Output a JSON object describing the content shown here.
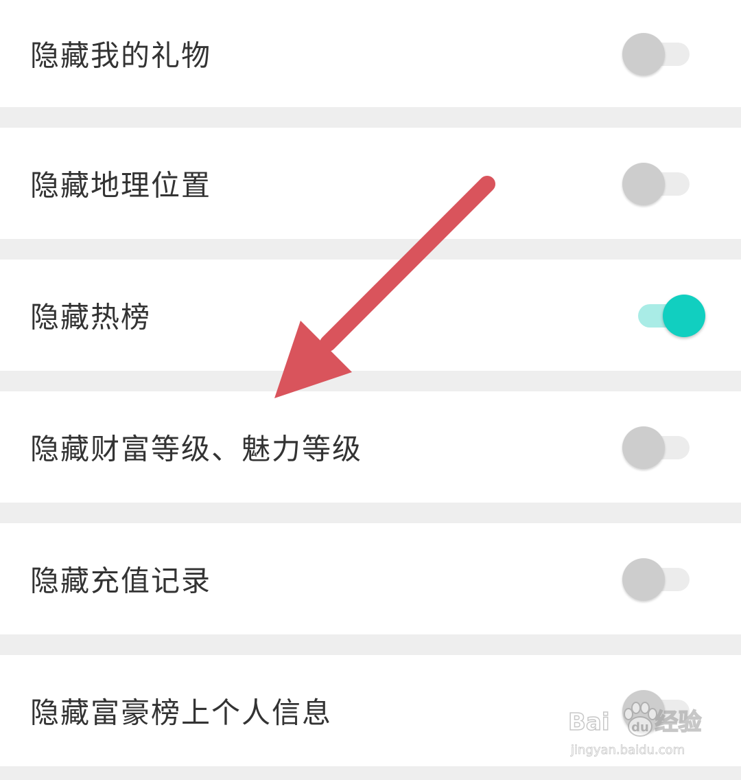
{
  "settings": {
    "items": [
      {
        "label": "隐藏我的礼物",
        "enabled": false
      },
      {
        "label": "隐藏地理位置",
        "enabled": false
      },
      {
        "label": "隐藏热榜",
        "enabled": true
      },
      {
        "label": "隐藏财富等级、魅力等级",
        "enabled": false
      },
      {
        "label": "隐藏充值记录",
        "enabled": false
      },
      {
        "label": "隐藏富豪榜上个人信息",
        "enabled": false
      }
    ]
  },
  "colors": {
    "toggle_on_knob": "#11cfc0",
    "toggle_on_track": "#a9ece6",
    "toggle_off_knob": "#cdcdcd",
    "toggle_off_track": "#ececec",
    "annotation_arrow": "#d9545c",
    "separator": "#eeeeee"
  },
  "annotation": {
    "type": "arrow",
    "icon": "arrow-icon"
  },
  "watermark": {
    "brand": "Baidu经验",
    "brand_text": "Bai",
    "brand_text_2": "经验",
    "url": "jingyan.baidu.com"
  }
}
